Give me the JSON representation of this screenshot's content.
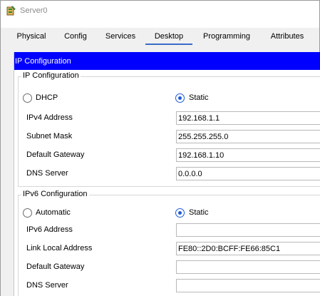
{
  "window": {
    "title": "Server0"
  },
  "tabs": [
    {
      "label": "Physical"
    },
    {
      "label": "Config"
    },
    {
      "label": "Services"
    },
    {
      "label": "Desktop"
    },
    {
      "label": "Programming"
    },
    {
      "label": "Attributes"
    }
  ],
  "active_tab": "Desktop",
  "panel": {
    "title": "IP Configuration"
  },
  "ipv4": {
    "title": "IP Configuration",
    "mode_dhcp_label": "DHCP",
    "mode_static_label": "Static",
    "selected_mode": "Static",
    "fields": [
      {
        "label": "IPv4 Address",
        "value": "192.168.1.1"
      },
      {
        "label": "Subnet Mask",
        "value": "255.255.255.0"
      },
      {
        "label": "Default Gateway",
        "value": "192.168.1.10"
      },
      {
        "label": "DNS Server",
        "value": "0.0.0.0"
      }
    ]
  },
  "ipv6": {
    "title": "IPv6 Configuration",
    "mode_auto_label": "Automatic",
    "mode_static_label": "Static",
    "selected_mode": "Static",
    "fields": [
      {
        "label": "IPv6 Address",
        "value": ""
      },
      {
        "label": "Link Local Address",
        "value": "FE80::2D0:BCFF:FE66:85C1"
      },
      {
        "label": "Default Gateway",
        "value": ""
      },
      {
        "label": "DNS Server",
        "value": ""
      }
    ]
  },
  "colors": {
    "header_bg": "#0000ff",
    "active_tab_underline": "#3a6bc9",
    "radio_selected": "#1e5bd6"
  }
}
